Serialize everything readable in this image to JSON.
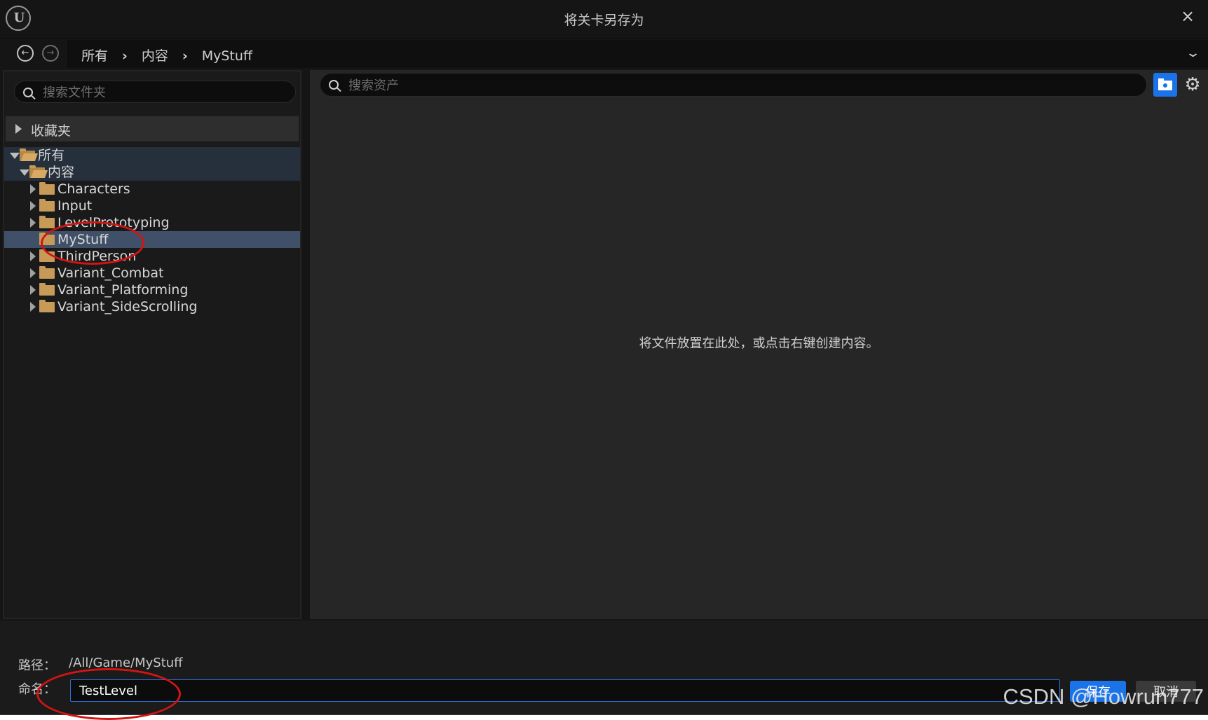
{
  "window": {
    "title": "将关卡另存为",
    "close_icon": "×"
  },
  "nav": {
    "back_icon": "arrow-left-icon",
    "forward_icon": "arrow-right-icon",
    "breadcrumb": [
      "所有",
      "内容",
      "MyStuff"
    ],
    "dropdown_icon": "chevron-down-icon"
  },
  "left_panel": {
    "search_placeholder": "搜索文件夹",
    "favorites_label": "收藏夹",
    "tree": [
      {
        "label": "所有",
        "level": 0,
        "expanded": true
      },
      {
        "label": "内容",
        "level": 1,
        "expanded": true
      },
      {
        "label": "Characters",
        "level": 2
      },
      {
        "label": "Input",
        "level": 2
      },
      {
        "label": "LevelPrototyping",
        "level": 2
      },
      {
        "label": "MyStuff",
        "level": 2,
        "selected": true
      },
      {
        "label": "ThirdPerson",
        "level": 2
      },
      {
        "label": "Variant_Combat",
        "level": 2
      },
      {
        "label": "Variant_Platforming",
        "level": 2
      },
      {
        "label": "Variant_SideScrolling",
        "level": 2
      }
    ]
  },
  "right_panel": {
    "search_placeholder": "搜索资产",
    "empty_hint": "将文件放置在此处，或点击右键创建内容。"
  },
  "bottom": {
    "path_label": "路径：",
    "path_value": "/All/Game/MyStuff",
    "name_label": "命名：",
    "name_value": "TestLevel",
    "save_label": "保存",
    "cancel_label": "取消"
  },
  "watermark": "CSDN @Howrun777",
  "colors": {
    "accent": "#1a73e8",
    "annotation": "#d21414",
    "folder": "#c79a58",
    "selection": "#3f5068"
  }
}
